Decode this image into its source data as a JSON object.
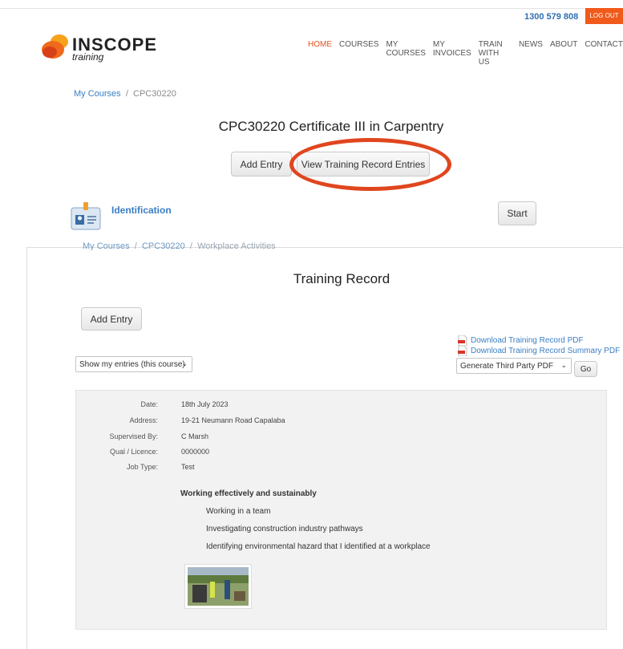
{
  "header": {
    "phone": "1300 579 808",
    "logout_label": "LOG OUT",
    "logo_main": "INSCOPE",
    "logo_sub": "training",
    "nav": [
      "HOME",
      "COURSES",
      "MY COURSES",
      "MY INVOICES",
      "TRAIN WITH US",
      "NEWS",
      "ABOUT",
      "CONTACT"
    ]
  },
  "course_page": {
    "breadcrumb_link": "My Courses",
    "breadcrumb_sep": "/",
    "breadcrumb_current": "CPC30220",
    "title": "CPC30220 Certificate III in Carpentry",
    "add_entry_label": "Add Entry",
    "view_entries_label": "View Training Record Entries",
    "module_label": "Identification",
    "start_label": "Start"
  },
  "record_page": {
    "breadcrumb_link1": "My Courses",
    "breadcrumb_link2": "CPC30220",
    "breadcrumb_current": "Workplace Activities",
    "title": "Training Record",
    "add_entry_label": "Add Entry",
    "download_pdf": "Download Training Record PDF",
    "download_summary_pdf": "Download Training Record Summary PDF",
    "filter_selected": "Show my entries (this course)",
    "third_party_selected": "Generate Third Party PDF",
    "go_label": "Go"
  },
  "entry": {
    "fields": [
      {
        "label": "Date:",
        "value": "18th July 2023"
      },
      {
        "label": "Address:",
        "value": "19-21 Neumann Road Capalaba"
      },
      {
        "label": "Supervised By:",
        "value": "C Marsh"
      },
      {
        "label": "Qual / Licence:",
        "value": "0000000"
      },
      {
        "label": "Job Type:",
        "value": "Test"
      }
    ],
    "section_title": "Working effectively and sustainably",
    "items": [
      "Working in a team",
      "Investigating construction industry pathways",
      "Identifying environmental hazard that I identified at a workplace"
    ]
  },
  "colors": {
    "accent_orange": "#f05a1a",
    "link_blue": "#3a7ec4",
    "highlight_red": "#e0461e"
  }
}
